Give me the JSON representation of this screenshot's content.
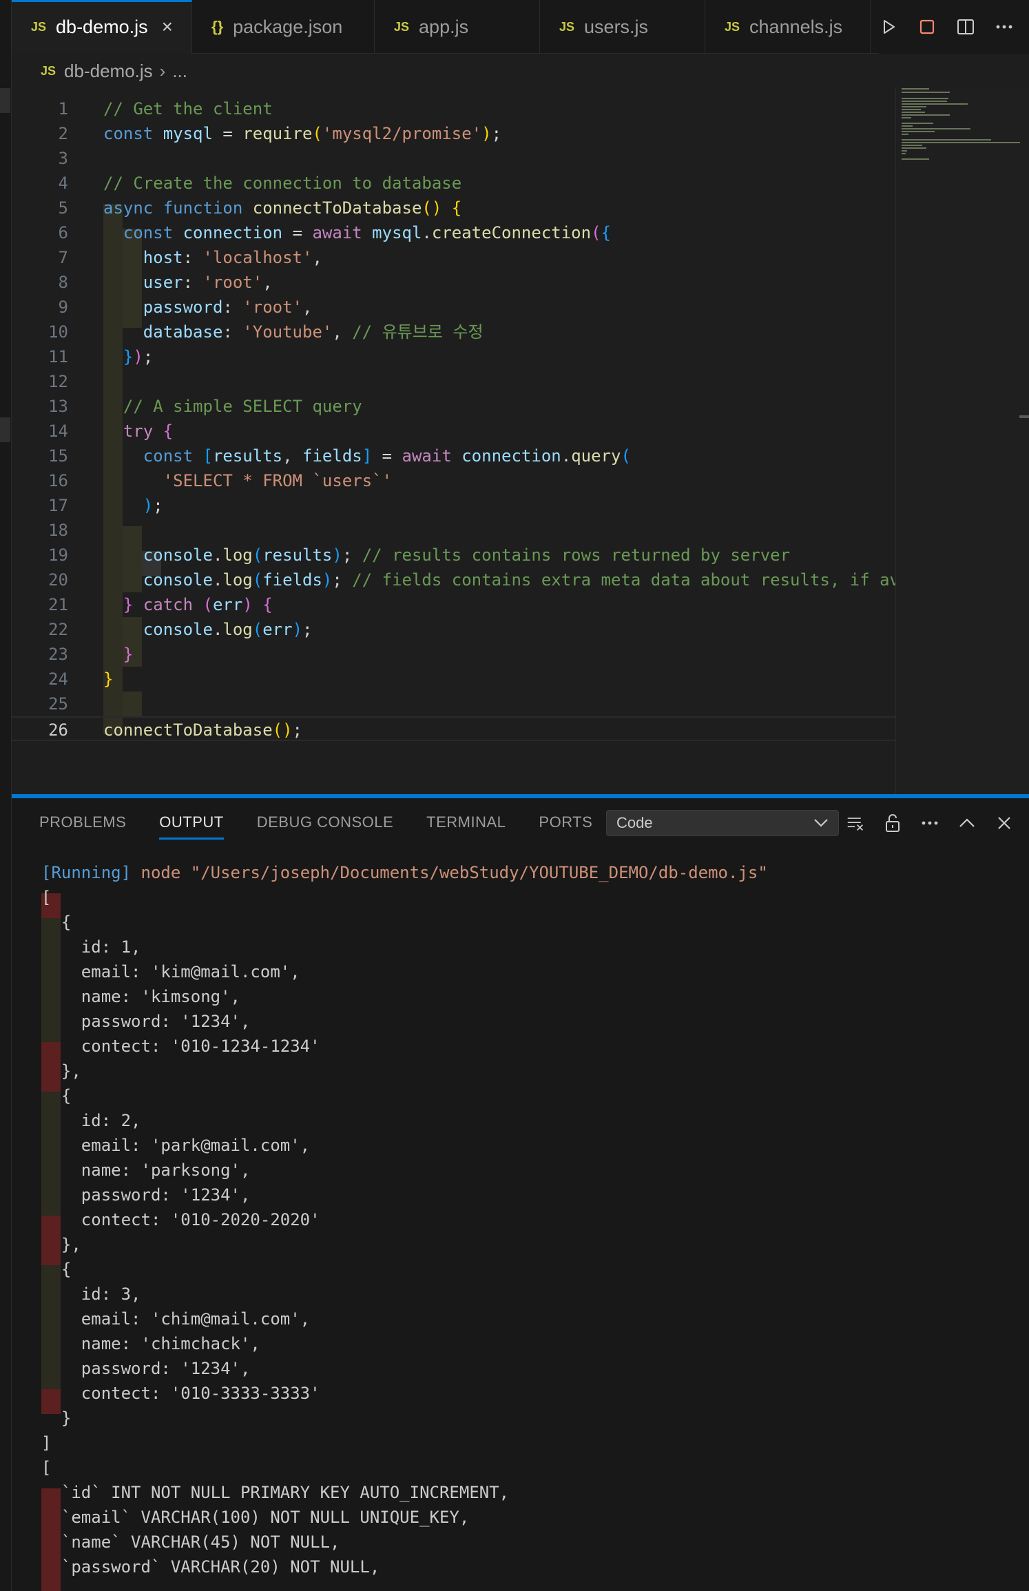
{
  "tabs": [
    {
      "label": "db-demo.js",
      "type": "js",
      "active": true
    },
    {
      "label": "package.json",
      "type": "json",
      "active": false
    },
    {
      "label": "app.js",
      "type": "js",
      "active": false
    },
    {
      "label": "users.js",
      "type": "js",
      "active": false
    },
    {
      "label": "channels.js",
      "type": "js",
      "active": false
    }
  ],
  "icons": {
    "js_badge": "JS",
    "json_badge": "{}",
    "close": "×",
    "run": "run-icon",
    "stop": "stop-icon",
    "split": "split-editor-icon",
    "more": "more-icon"
  },
  "breadcrumb": {
    "file": "db-demo.js",
    "more": "..."
  },
  "editor": {
    "current_line": 26,
    "lines": [
      "// Get the client",
      "const mysql = require('mysql2/promise');",
      "",
      "// Create the connection to database",
      "async function connectToDatabase() {",
      "  const connection = await mysql.createConnection({",
      "    host: 'localhost',",
      "    user: 'root',",
      "    password: 'root',",
      "    database: 'Youtube', // 유튜브로 수정",
      "  });",
      "",
      "  // A simple SELECT query",
      "  try {",
      "    const [results, fields] = await connection.query(",
      "      'SELECT * FROM `users`'",
      "    );",
      "",
      "    console.log(results); // results contains rows returned by server",
      "    console.log(fields); // fields contains extra meta data about results, if av",
      "  } catch (err) {",
      "    console.log(err);",
      "  }",
      "}",
      "",
      "connectToDatabase();"
    ]
  },
  "panel": {
    "tabs": [
      "PROBLEMS",
      "OUTPUT",
      "DEBUG CONSOLE",
      "TERMINAL",
      "PORTS"
    ],
    "active_tab": "OUTPUT",
    "channel": "Code"
  },
  "output": {
    "running_tag": "[Running]",
    "command": "node \"/Users/joseph/Documents/webStudy/YOUTUBE_DEMO/db-demo.js\"",
    "lines": [
      "[",
      "  {",
      "    id: 1,",
      "    email: 'kim@mail.com',",
      "    name: 'kimsong',",
      "    password: '1234',",
      "    contect: '010-1234-1234'",
      "  },",
      "  {",
      "    id: 2,",
      "    email: 'park@mail.com',",
      "    name: 'parksong',",
      "    password: '1234',",
      "    contect: '010-2020-2020'",
      "  },",
      "  {",
      "    id: 3,",
      "    email: 'chim@mail.com',",
      "    name: 'chimchack',",
      "    password: '1234',",
      "    contect: '010-3333-3333'",
      "  }",
      "]",
      "[",
      "  `id` INT NOT NULL PRIMARY KEY AUTO_INCREMENT,",
      "  `email` VARCHAR(100) NOT NULL UNIQUE_KEY,",
      "  `name` VARCHAR(45) NOT NULL,",
      "  `password` VARCHAR(20) NOT NULL,"
    ]
  },
  "colors": {
    "accent": "#0078d4",
    "js_icon": "#cbcb41",
    "comment": "#6a9955",
    "keyword": "#569cd6",
    "string": "#ce9178"
  }
}
